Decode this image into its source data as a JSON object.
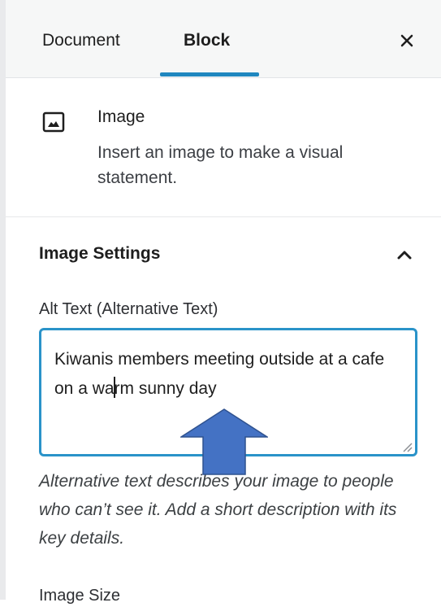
{
  "tabs": {
    "document_label": "Document",
    "block_label": "Block",
    "active": "Block"
  },
  "header": {
    "close_icon": "close-icon"
  },
  "block_card": {
    "icon": "image-icon",
    "title": "Image",
    "description": "Insert an image to make a visual statement."
  },
  "image_settings": {
    "title": "Image Settings",
    "toggle_icon": "chevron-up-icon",
    "alt_text": {
      "label": "Alt Text (Alternative Text)",
      "value": "Kiwanis members meeting outside at a cafe on a warm sunny day",
      "help": "Alternative text describes your image to people who can’t see it. Add a short description with its key details."
    },
    "next_field_label": "Image Size"
  },
  "colors": {
    "accent": "#1f87bf",
    "focus_border": "#2a93c9",
    "annotation_arrow": "#4472c4"
  }
}
